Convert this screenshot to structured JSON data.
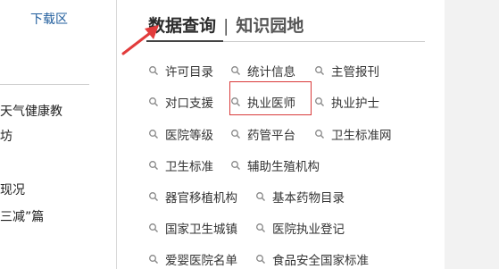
{
  "left": {
    "download_label": "下载区",
    "items": [
      "天气健康教",
      "坊",
      "现况",
      "三减”篇"
    ]
  },
  "section": {
    "title": "数据查询",
    "separator": "|",
    "subtitle": "知识园地"
  },
  "links": [
    "许可目录",
    "统计信息",
    "主管报刊",
    "对口支援",
    "执业医师",
    "执业护士",
    "医院等级",
    "药管平台",
    "卫生标准网",
    "卫生标准",
    "辅助生殖机构",
    "器官移植机构",
    "基本药物目录",
    "国家卫生城镇",
    "医院执业登记",
    "爱婴医院名单",
    "食品安全国家标准"
  ],
  "colors": {
    "accent_red": "#e23b3b",
    "link_blue": "#1f5c9c"
  },
  "icons": {
    "link_icon": "magnifier-icon",
    "pointer": "red-arrow-icon"
  }
}
